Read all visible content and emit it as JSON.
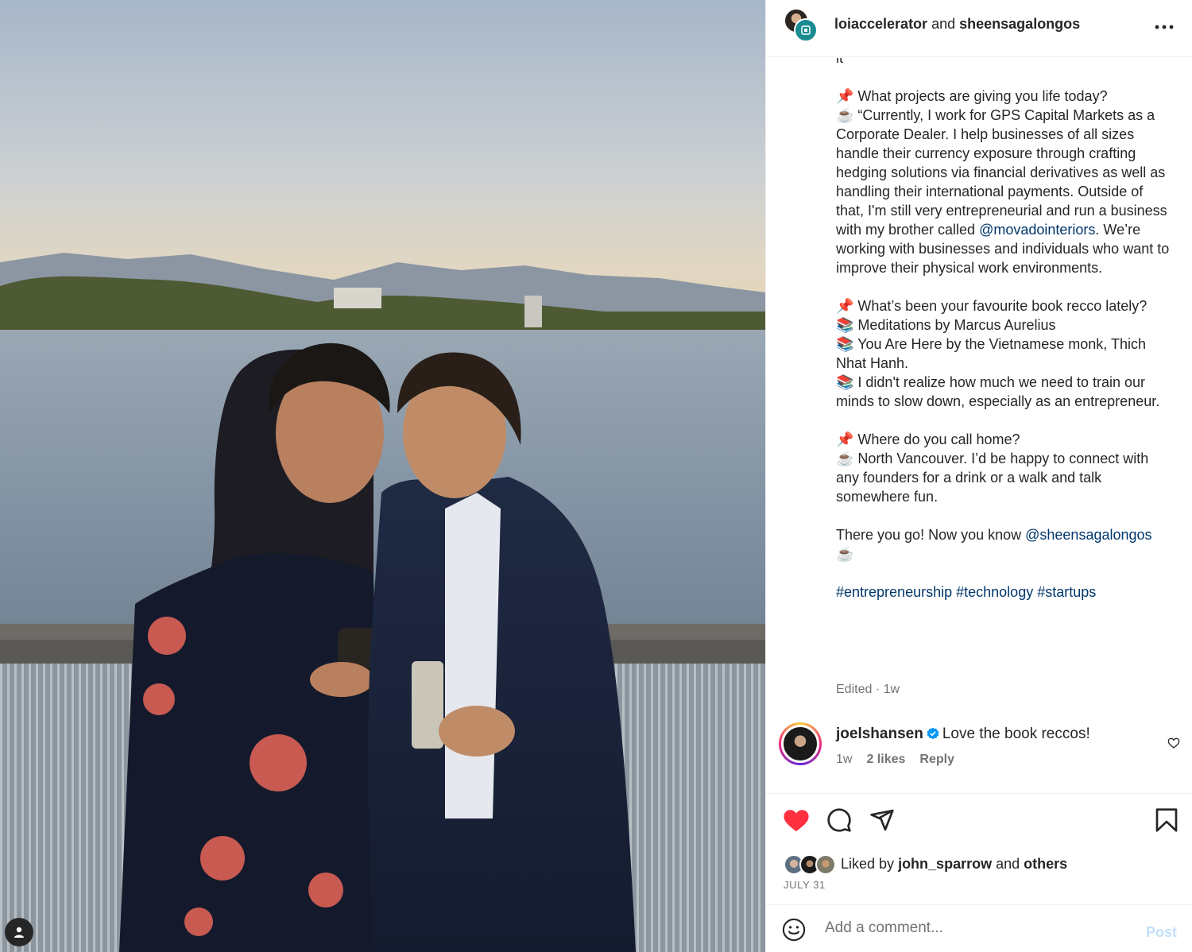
{
  "header": {
    "account_primary": "loiaccelerator",
    "joiner": "and",
    "account_secondary": "sheensagalongos",
    "more_icon": "more-horizontal-icon"
  },
  "caption": {
    "fragment_top": "it",
    "q1": "📌 What projects are giving you life today?",
    "a1_line1": "☕️ “Currently, I work for GPS Capital Markets as a Corporate Dealer. I help businesses of all sizes handle their currency exposure through crafting hedging solutions via financial derivatives as well as handling their international payments. Outside of that, I'm still very entrepreneurial and run a business with my brother called ",
    "a1_mention": "@movadointeriors",
    "a1_line2": ". We’re working with businesses and individuals who want to improve their physical work environments.",
    "q2": "📌 What’s been your favourite book recco lately?",
    "b1": "📚 Meditations by Marcus Aurelius",
    "b2": "📚 You Are Here by the Vietnamese monk, Thich Nhat Hanh.",
    "b3": "📚 I didn't realize how much we need to train our minds to slow down, especially as an entrepreneur.",
    "q3": "📌 Where do you call home?",
    "a3": "☕️ North Vancouver. I’d be happy to connect with any founders for a drink or a walk and talk somewhere fun.",
    "outro": "There you go! Now you know ",
    "outro_mention": "@sheensagalongos",
    "outro_emoji": " ☕️",
    "hashtag1": "#entrepreneurship",
    "hashtag2": "#technology",
    "hashtag3": "#startups",
    "edited": "Edited",
    "edited_sep": " · ",
    "edited_time": "1w"
  },
  "comment": {
    "user": "joelshansen",
    "text": "Love the book reccos!",
    "time": "1w",
    "likes": "2 likes",
    "reply": "Reply"
  },
  "actions": {
    "like_icon": "heart-filled-icon",
    "comment_icon": "comment-icon",
    "share_icon": "share-icon",
    "save_icon": "bookmark-icon",
    "like_color": "#ff3040"
  },
  "likes": {
    "prefix": "Liked by",
    "user": "john_sparrow",
    "joiner": "and",
    "others": "others"
  },
  "date": "JULY 31",
  "comment_box": {
    "placeholder": "Add a comment...",
    "post": "Post"
  },
  "colors": {
    "link": "#00376b",
    "meta": "#737373",
    "post_disabled": "#c3dffb"
  }
}
